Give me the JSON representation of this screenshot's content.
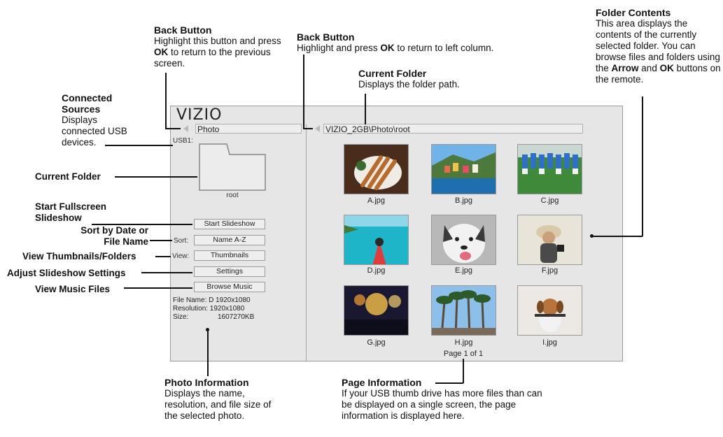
{
  "annotations": {
    "back_left": {
      "title": "Back Button",
      "pre": "Highlight this button and press ",
      "bold": "OK",
      "post": " to return to the previous screen."
    },
    "back_right": {
      "title": "Back Button",
      "pre": "Highlight and press ",
      "bold": "OK",
      "post": " to return to left column."
    },
    "current_folder_top": {
      "title": "Current Folder",
      "text": "Displays the folder path."
    },
    "folder_contents": {
      "title": "Folder Contents",
      "pre": "This area displays the contents of the currently selected folder. You can browse files and folders using the ",
      "b1": "Arrow",
      "mid": " and ",
      "b2": "OK",
      "post": " buttons on the remote."
    },
    "connected_sources": {
      "title": "Connected Sources",
      "text": "Displays connected USB devices."
    },
    "current_folder_left": "Current Folder",
    "start_slideshow": "Start Fullscreen Slideshow",
    "sort": "Sort by Date or File Name",
    "view": "View Thumbnails/Folders",
    "settings": "Adjust Slideshow Settings",
    "music": "View Music Files",
    "photo_info": {
      "title": "Photo Information",
      "text": "Displays the name, resolution, and file size of the selected photo."
    },
    "page_info": {
      "title": "Page Information",
      "text": "If your USB thumb drive has more files than can be displayed on a single screen, the page information is displayed here."
    }
  },
  "screen": {
    "brand": "VIZIO",
    "left_path": "Photo",
    "right_path": "VIZIO_2GB\\Photo\\root",
    "usb_label": "USB1:",
    "folder_name": "root",
    "start_button": "Start Slideshow",
    "sort_label": "Sort:",
    "sort_value": "Name A-Z",
    "view_label": "View:",
    "view_value": "Thumbnails",
    "settings_button": "Settings",
    "music_button": "Browse Music",
    "file_name": "File Name: D 1920x1080",
    "resolution": "Resolution: 1920x1080",
    "size_label": "Size:",
    "size_value": "1607270KB",
    "page": "Page 1 of 1",
    "files": [
      "A.jpg",
      "B.jpg",
      "C.jpg",
      "D.jpg",
      "E.jpg",
      "F.jpg",
      "G.jpg",
      "H.jpg",
      "I.jpg"
    ]
  }
}
